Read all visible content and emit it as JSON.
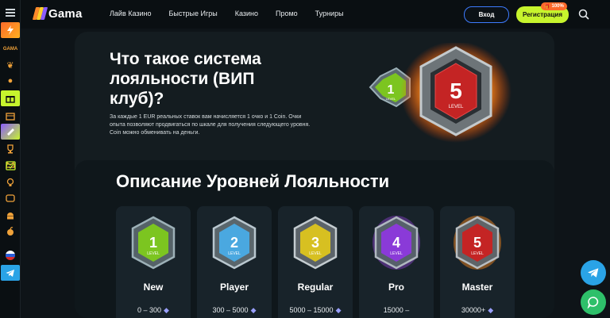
{
  "header": {
    "logo_text": "Gama",
    "nav": [
      "Лайв Казино",
      "Быстрые Игры",
      "Казино",
      "Промо",
      "Турниры"
    ],
    "login_label": "Вход",
    "register_label": "Регистрация",
    "bonus_badge": "100%"
  },
  "sidebar": {
    "items": [
      "menu-icon",
      "lightning-icon",
      "text-label",
      "cherry-icon",
      "pumpkin-icon",
      "gift-icon",
      "box-icon",
      "ticket-icon",
      "trophy-icon",
      "crown-icon",
      "calendar-icon",
      "bulb-icon",
      "game-icon",
      "android-icon",
      "apple-icon",
      "flag-ru-icon",
      "telegram-icon"
    ],
    "small_text": "GAMA"
  },
  "hero": {
    "title": "Что такое система лояльности (ВИП клуб)?",
    "text": "За каждые 1 EUR реальных ставок вам начисляется 1 очко и 1 Coin. Очки опыта позволяют продвигаться по шкале для получения следующего уровня. Coin можно обменивать на деньги.",
    "badge_small_number": "1",
    "badge_small_label": "LEVEL",
    "badge_big_number": "5",
    "badge_big_label": "LEVEL"
  },
  "levels": {
    "title": "Описание Уровней Лояльности",
    "cards": [
      {
        "number": "1",
        "label": "LEVEL",
        "name": "New",
        "range": "0 – 300",
        "color": "#7cc520",
        "frame": "#9db1b8"
      },
      {
        "number": "2",
        "label": "LEVEL",
        "name": "Player",
        "range": "300 – 5000",
        "color": "#4aa8e0",
        "frame": "#b9c7cf"
      },
      {
        "number": "3",
        "label": "LEVEL",
        "name": "Regular",
        "range": "5000 – 15000",
        "color": "#d7c021",
        "frame": "#c4ccd0"
      },
      {
        "number": "4",
        "label": "LEVEL",
        "name": "Pro",
        "range": "15000 –",
        "color": "#8a3ad8",
        "frame": "#b0b8c0"
      },
      {
        "number": "5",
        "label": "LEVEL",
        "name": "Master",
        "range": "30000+",
        "color": "#c42424",
        "frame": "#b8bec2"
      }
    ]
  },
  "colors": {
    "accent_green": "#c7f42d",
    "accent_blue": "#3d7bff",
    "background": "#0e1418",
    "card": "#18232a"
  }
}
